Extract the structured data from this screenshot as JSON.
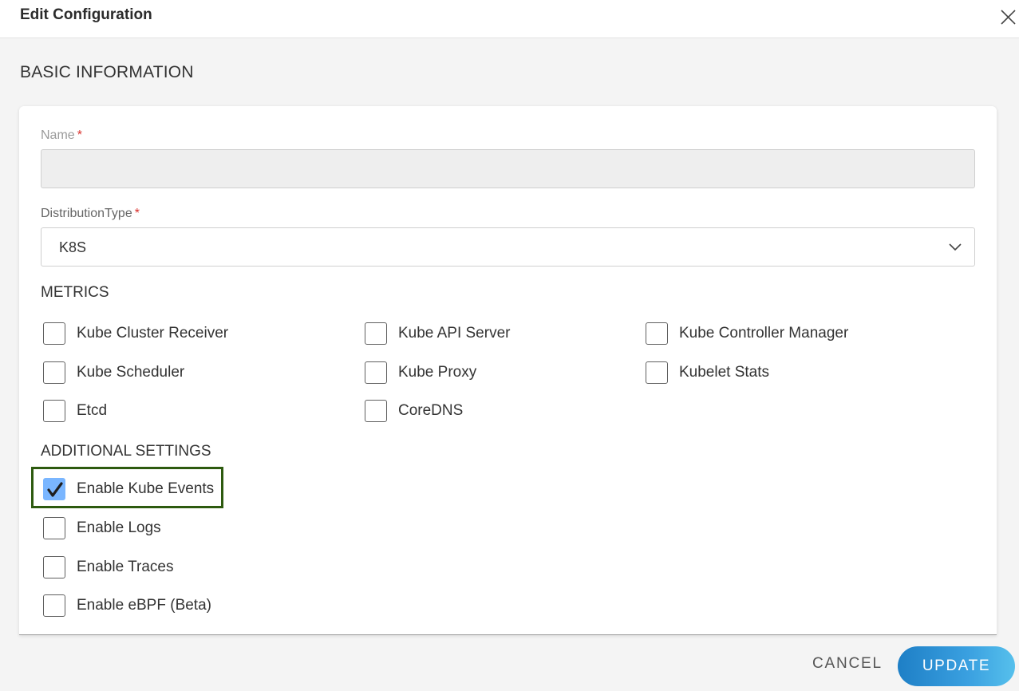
{
  "dialog": {
    "title": "Edit Configuration",
    "close_icon": "close-icon"
  },
  "section_title": "BASIC INFORMATION",
  "form": {
    "name": {
      "label": "Name",
      "required_mark": "*",
      "value": "",
      "disabled": true
    },
    "distribution_type": {
      "label": "DistributionType",
      "required_mark": "*",
      "value": "K8S",
      "icon": "chevron-down-icon"
    }
  },
  "metrics": {
    "title": "METRICS",
    "items": [
      {
        "label": "Kube Cluster Receiver",
        "checked": false
      },
      {
        "label": "Kube API Server",
        "checked": false
      },
      {
        "label": "Kube Controller Manager",
        "checked": false
      },
      {
        "label": "Kube Scheduler",
        "checked": false
      },
      {
        "label": "Kube Proxy",
        "checked": false
      },
      {
        "label": "Kubelet Stats",
        "checked": false
      },
      {
        "label": "Etcd",
        "checked": false
      },
      {
        "label": "CoreDNS",
        "checked": false
      }
    ]
  },
  "additional": {
    "title": "ADDITIONAL SETTINGS",
    "items": [
      {
        "label": "Enable Kube Events",
        "checked": true
      },
      {
        "label": "Enable Logs",
        "checked": false
      },
      {
        "label": "Enable Traces",
        "checked": false
      },
      {
        "label": "Enable eBPF (Beta)",
        "checked": false
      }
    ]
  },
  "footer": {
    "cancel_label": "CANCEL",
    "update_label": "UPDATE"
  },
  "colors": {
    "accent": "#1e7fc6",
    "checked_box": "#7ab6ff",
    "highlight_border": "#2d5a0f",
    "required": "#d9302c"
  }
}
